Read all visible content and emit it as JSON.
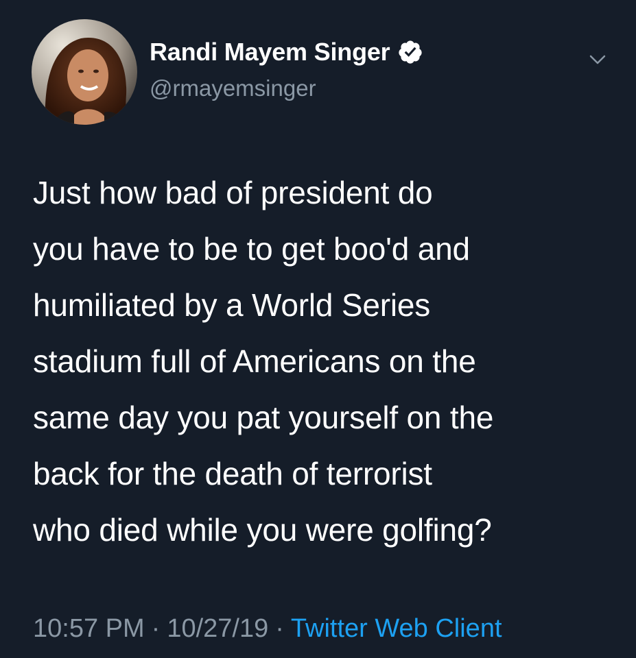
{
  "author": {
    "display_name": "Randi Mayem Singer",
    "handle": "@rmayemsinger",
    "verified": true,
    "avatar_icon": "profile-photo"
  },
  "tweet": {
    "text": "Just how bad of president do\nyou have to be to get boo'd and\nhumiliated by a World Series\nstadium full of Americans on the\nsame day you pat yourself on the\nback for the death of terrorist\nwho died while you were golfing?",
    "time": "10:57 PM",
    "date": "10/27/19",
    "separator": "·",
    "client": "Twitter Web Client"
  },
  "colors": {
    "background": "#151d29",
    "text": "#ffffff",
    "secondary_text": "#8b98a5",
    "accent": "#1da1f2"
  },
  "icons": {
    "verified": "verified-badge-icon",
    "menu": "chevron-down-icon"
  }
}
